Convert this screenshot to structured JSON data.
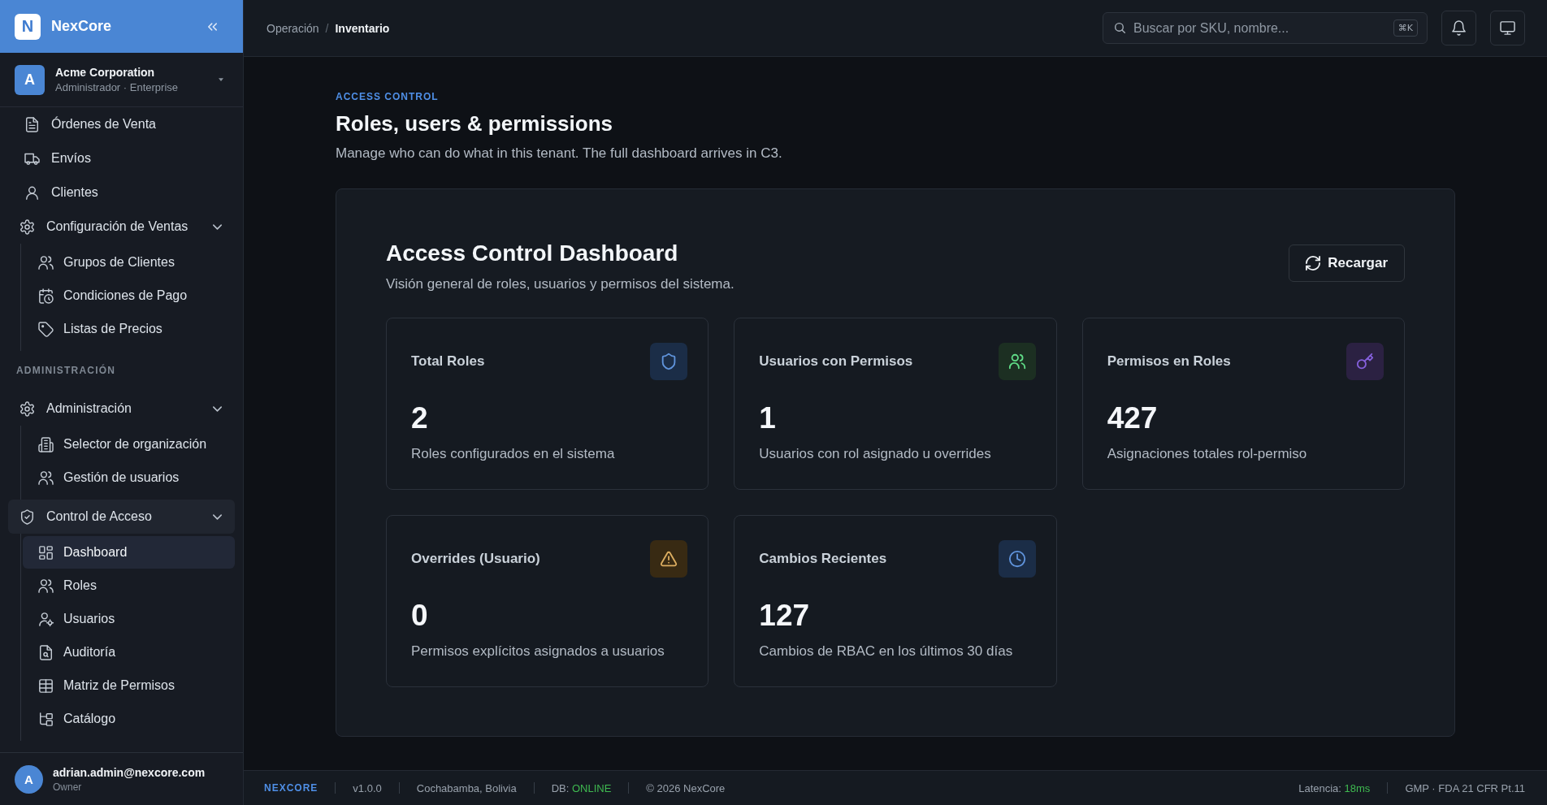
{
  "sidebar": {
    "brand": {
      "logo_letter": "N",
      "name": "NexCore"
    },
    "organization": {
      "avatar_letter": "A",
      "name": "Acme Corporation",
      "subtitle": "Administrador · Enterprise"
    },
    "sections": [
      {
        "items": [
          {
            "label": "Órdenes de Venta",
            "selected": false
          },
          {
            "label": "Envíos",
            "selected": false
          },
          {
            "label": "Clientes",
            "selected": false
          },
          {
            "label": "Configuración de Ventas",
            "selected": false,
            "expanded": true,
            "children": [
              {
                "label": "Grupos de Clientes",
                "selected": false
              },
              {
                "label": "Condiciones de Pago",
                "selected": false
              },
              {
                "label": "Listas de Precios",
                "selected": false
              }
            ]
          }
        ]
      },
      {
        "label": "ADMINISTRACIÓN",
        "items": [
          {
            "label": "Administración",
            "selected": false,
            "expanded": true,
            "children": [
              {
                "label": "Selector de organización",
                "selected": false
              },
              {
                "label": "Gestión de usuarios",
                "selected": false
              }
            ]
          },
          {
            "label": "Control de Acceso",
            "selected": true,
            "expanded": true,
            "children": [
              {
                "label": "Dashboard",
                "selected": true
              },
              {
                "label": "Roles",
                "selected": false
              },
              {
                "label": "Usuarios",
                "selected": false
              },
              {
                "label": "Auditoría",
                "selected": false
              },
              {
                "label": "Matriz de Permisos",
                "selected": false
              },
              {
                "label": "Catálogo",
                "selected": false
              }
            ]
          }
        ]
      }
    ],
    "user": {
      "avatar_letter": "A",
      "email": "adrian.admin@nexcore.com",
      "role": "Owner"
    }
  },
  "topbar": {
    "breadcrumb": {
      "separator": "/",
      "items": [
        {
          "label": "Operación",
          "current": false
        },
        {
          "label": "Inventario",
          "current": true
        }
      ]
    },
    "search": {
      "placeholder": "Buscar por SKU, nombre...",
      "shortcut": "⌘K"
    }
  },
  "page": {
    "eyebrow": "ACCESS CONTROL",
    "title": "Roles, users & permissions",
    "subtitle": "Manage who can do what in this tenant. The full dashboard arrives in C3."
  },
  "dashboard": {
    "title": "Access Control Dashboard",
    "subtitle": "Visión general de roles, usuarios y permisos del sistema.",
    "reload_button": "Recargar",
    "stats": [
      {
        "title": "Total Roles",
        "value": "2",
        "description": "Roles configurados en el sistema",
        "color": "#1b2d47"
      },
      {
        "title": "Usuarios con Permisos",
        "value": "1",
        "description": "Usuarios con rol asignado u overrides",
        "color": "#1c2f22"
      },
      {
        "title": "Permisos en Roles",
        "value": "427",
        "description": "Asignaciones totales rol-permiso",
        "color": "#2b2142"
      },
      {
        "title": "Overrides (Usuario)",
        "value": "0",
        "description": "Permisos explícitos asignados a usuarios",
        "color": "#382a13"
      },
      {
        "title": "Cambios Recientes",
        "value": "127",
        "description": "Cambios de RBAC en los últimos 30 días",
        "color": "#1b2d47"
      }
    ]
  },
  "footer": {
    "left": [
      {
        "kind": "brand",
        "text": "NEXCORE"
      },
      {
        "kind": "text",
        "text": "v1.0.0"
      },
      {
        "kind": "text",
        "text": "Cochabamba, Bolivia"
      },
      {
        "kind": "metric",
        "label": "DB:",
        "value": "ONLINE"
      },
      {
        "kind": "text",
        "text": "© 2026 NexCore"
      }
    ],
    "right": [
      {
        "kind": "metric",
        "label": "Latencia:",
        "value": "18ms"
      },
      {
        "kind": "text",
        "text": "GMP · FDA 21 CFR Pt.11"
      }
    ]
  }
}
